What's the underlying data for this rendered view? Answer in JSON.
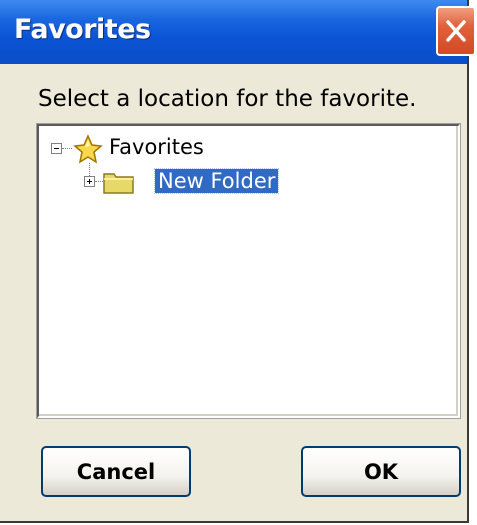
{
  "window": {
    "title": "Favorites",
    "close_icon": "close-x-icon"
  },
  "prompt": "Select a location for the favorite.",
  "tree": {
    "root": {
      "label": "Favorites",
      "icon": "star-icon",
      "expanded": true
    },
    "children": [
      {
        "label": "New Folder",
        "icon": "folder-icon",
        "expanded": false,
        "selected": true
      }
    ]
  },
  "buttons": {
    "cancel_label": "Cancel",
    "ok_label": "OK"
  },
  "colors": {
    "titlebar": "#0a54d4",
    "selection": "#316ac5",
    "dialog_bg": "#ece9d8",
    "close_button": "#d24a24"
  }
}
